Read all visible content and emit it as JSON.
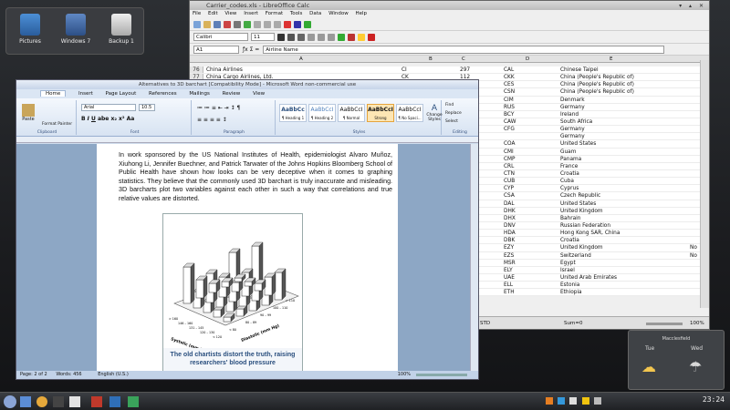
{
  "desktop": {
    "icons": [
      {
        "label": "Pictures",
        "icon": "folder-icon"
      },
      {
        "label": "Windows 7",
        "icon": "windows-icon"
      },
      {
        "label": "Backup 1",
        "icon": "drive-icon"
      }
    ]
  },
  "calc": {
    "title": "Carrier_codes.xls - LibreOffice Calc",
    "menu": [
      "File",
      "Edit",
      "View",
      "Insert",
      "Format",
      "Tools",
      "Data",
      "Window",
      "Help"
    ],
    "font_name": "Calibri",
    "font_size": "11",
    "cell_ref": "A1",
    "formula": "Airline Name",
    "columns": [
      "A",
      "B",
      "C",
      "D",
      "E"
    ],
    "rows": [
      {
        "n": "76",
        "a": "China Airlines",
        "b": "CI",
        "c": "297",
        "d": "CAL",
        "e": "Chinese Taipei"
      },
      {
        "n": "77",
        "a": "China Cargo Airlines, Ltd.",
        "b": "CK",
        "c": "112",
        "d": "CKK",
        "e": "China (People's Republic of)"
      },
      {
        "n": "",
        "a": "",
        "b": "",
        "c": "",
        "d": "CES",
        "e": "China (People's Republic of)"
      },
      {
        "n": "",
        "a": "",
        "b": "",
        "c": "",
        "d": "CSN",
        "e": "China (People's Republic of)"
      },
      {
        "n": "",
        "a": "",
        "b": "",
        "c": "",
        "d": "CIM",
        "e": "Denmark"
      },
      {
        "n": "",
        "a": "",
        "b": "",
        "c": "",
        "d": "RUS",
        "e": "Germany"
      },
      {
        "n": "",
        "a": "",
        "b": "",
        "c": "",
        "d": "BCY",
        "e": "Ireland"
      },
      {
        "n": "",
        "a": "",
        "b": "",
        "c": "",
        "d": "CAW",
        "e": "South Africa"
      },
      {
        "n": "",
        "a": "",
        "b": "",
        "c": "",
        "d": "CFG",
        "e": "Germany"
      },
      {
        "n": "",
        "a": "",
        "b": "",
        "c": "",
        "d": "",
        "e": "Germany"
      },
      {
        "n": "",
        "a": "",
        "b": "",
        "c": "",
        "d": "COA",
        "e": "United States"
      },
      {
        "n": "",
        "a": "",
        "b": "",
        "c": "",
        "d": "CMI",
        "e": "Guam"
      },
      {
        "n": "",
        "a": "",
        "b": "",
        "c": "",
        "d": "CMP",
        "e": "Panama"
      },
      {
        "n": "",
        "a": "",
        "b": "",
        "c": "",
        "d": "CRL",
        "e": "France"
      },
      {
        "n": "",
        "a": "",
        "b": "",
        "c": "",
        "d": "CTN",
        "e": "Croatia"
      },
      {
        "n": "",
        "a": "",
        "b": "",
        "c": "",
        "d": "CUB",
        "e": "Cuba"
      },
      {
        "n": "",
        "a": "",
        "b": "",
        "c": "",
        "d": "CYP",
        "e": "Cyprus"
      },
      {
        "n": "",
        "a": "",
        "b": "",
        "c": "",
        "d": "CSA",
        "e": "Czech Republic"
      },
      {
        "n": "",
        "a": "",
        "b": "",
        "c": "",
        "d": "DAL",
        "e": "United States"
      },
      {
        "n": "",
        "a": "",
        "b": "",
        "c": "",
        "d": "DHK",
        "e": "United Kingdom"
      },
      {
        "n": "",
        "a": "",
        "b": "",
        "c": "",
        "d": "DHX",
        "e": "Bahrain"
      },
      {
        "n": "",
        "a": "",
        "b": "",
        "c": "",
        "d": "DNV",
        "e": "Russian Federation"
      },
      {
        "n": "",
        "a": "",
        "b": "",
        "c": "",
        "d": "HDA",
        "e": "Hong Kong SAR, China"
      },
      {
        "n": "",
        "a": "",
        "b": "",
        "c": "",
        "d": "DBK",
        "e": "Croatia"
      },
      {
        "n": "",
        "a": "",
        "b": "",
        "c": "",
        "d": "EZY",
        "e": "United Kingdom"
      },
      {
        "n": "",
        "a": "",
        "b": "",
        "c": "",
        "d": "EZS",
        "e": "Switzerland"
      },
      {
        "n": "",
        "a": "",
        "b": "",
        "c": "",
        "d": "MSR",
        "e": "Egypt"
      },
      {
        "n": "",
        "a": "",
        "b": "",
        "c": "",
        "d": "ELY",
        "e": "Israel"
      },
      {
        "n": "",
        "a": "",
        "b": "",
        "c": "",
        "d": "UAE",
        "e": "United Arab Emirates"
      },
      {
        "n": "",
        "a": "",
        "b": "",
        "c": "",
        "d": "ELL",
        "e": "Estonia"
      },
      {
        "n": "",
        "a": "",
        "b": "",
        "c": "",
        "d": "ETH",
        "e": "Ethiopia"
      }
    ],
    "extra_col": [
      "No",
      "No"
    ],
    "status_sum": "Sum=0",
    "status_zoom": "100%",
    "status_mode": "STD"
  },
  "word": {
    "title": "Alternatives to 3D barchart [Compatibility Mode] - Microsoft Word non-commercial use",
    "tabs": [
      "Home",
      "Insert",
      "Page Layout",
      "References",
      "Mailings",
      "Review",
      "View"
    ],
    "font_name": "Arial",
    "font_size": "10.5",
    "styles": [
      {
        "sample": "AaBbCc",
        "name": "¶ Heading 1"
      },
      {
        "sample": "AaBbCcI",
        "name": "¶ Heading 2"
      },
      {
        "sample": "AaBbCcI",
        "name": "¶ Normal"
      },
      {
        "sample": "AaBbCcI",
        "name": "Strong"
      },
      {
        "sample": "AaBbCcI",
        "name": "¶ No Spaci..."
      }
    ],
    "ribbon_groups": [
      "Clipboard",
      "Font",
      "Paragraph",
      "Styles",
      "Editing"
    ],
    "paste": "Paste",
    "format_painter": "Format Painter",
    "change_styles": "Change Styles",
    "find": "Find",
    "replace": "Replace",
    "select": "Select",
    "paragraph": "In work sponsored by the US National Institutes of Health, epidemiologist Alvaro Muñoz, Xiuhong Li, Jennifer Buechner, and Patrick Tarwater of the Johns Hopkins Bloomberg School of Public Health have shown how looks can be very deceptive when it comes to graphing statistics. They believe that the commonly used 3D barchart is truly inaccurate and misleading. 3D barcharts plot two variables against each other in such a way that correlations and true relative values are distorted.",
    "caption": "The old chartists distort the truth, raising researchers' blood pressure",
    "figure": {
      "axis_systolic": "Systolic (mm Hg)",
      "axis_diastolic": "Diastolic (mm Hg)",
      "systolic_ticks": [
        "> 160",
        "146 – 160",
        "131 – 145",
        "120 – 130",
        "< 120"
      ],
      "diastolic_ticks": [
        "< 80",
        "80 – 89",
        "90 – 99",
        "100 – 110",
        "> 110"
      ]
    },
    "status_page": "Page: 2 of 2",
    "status_words": "Words: 456",
    "status_lang": "English (U.S.)",
    "status_zoom": "100%"
  },
  "weather": {
    "location": "Macclesfield",
    "days": [
      {
        "day": "Tue",
        "icon": "cloud-sun-icon"
      },
      {
        "day": "Wed",
        "icon": "cloud-rain-icon"
      }
    ]
  },
  "taskbar": {
    "time": "23:24"
  },
  "colors": {
    "word_accent": "#2a4f7e",
    "desktop": "#1d1f22"
  }
}
